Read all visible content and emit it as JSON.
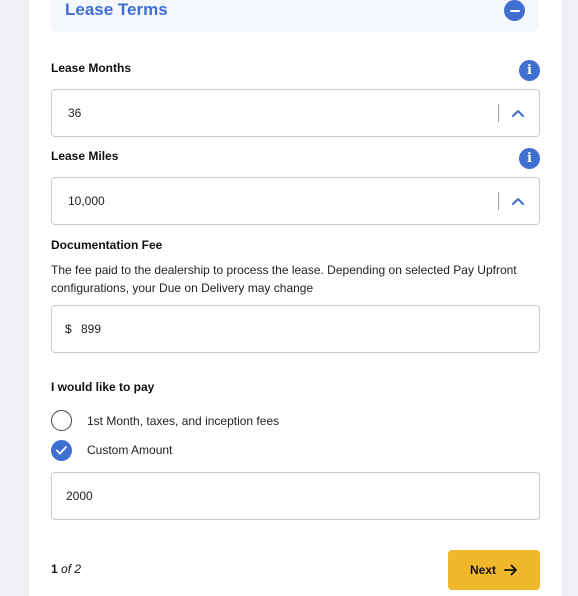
{
  "section": {
    "title": "Lease Terms",
    "collapse_icon": "minus-circle-icon"
  },
  "lease_months": {
    "label": "Lease Months",
    "value": "36",
    "info_icon": "i"
  },
  "lease_miles": {
    "label": "Lease Miles",
    "value": "10,000",
    "info_icon": "i"
  },
  "documentation_fee": {
    "label": "Documentation Fee",
    "description": "The fee paid to the dealership to process the lease. Depending on selected Pay Upfront configurations, your Due on Delivery may change",
    "currency": "$",
    "value": "899"
  },
  "payment": {
    "label": "I would like to pay",
    "options": [
      {
        "label": "1st Month, taxes, and inception fees",
        "selected": false
      },
      {
        "label": "Custom Amount",
        "selected": true
      }
    ],
    "custom_amount": "2000"
  },
  "pager": {
    "current": "1",
    "of_text": "of 2"
  },
  "next_button": {
    "label": "Next",
    "icon": "arrow-right-icon"
  },
  "colors": {
    "accent": "#3f6fd1",
    "button": "#f0b72d",
    "border": "#c9ccd1"
  }
}
